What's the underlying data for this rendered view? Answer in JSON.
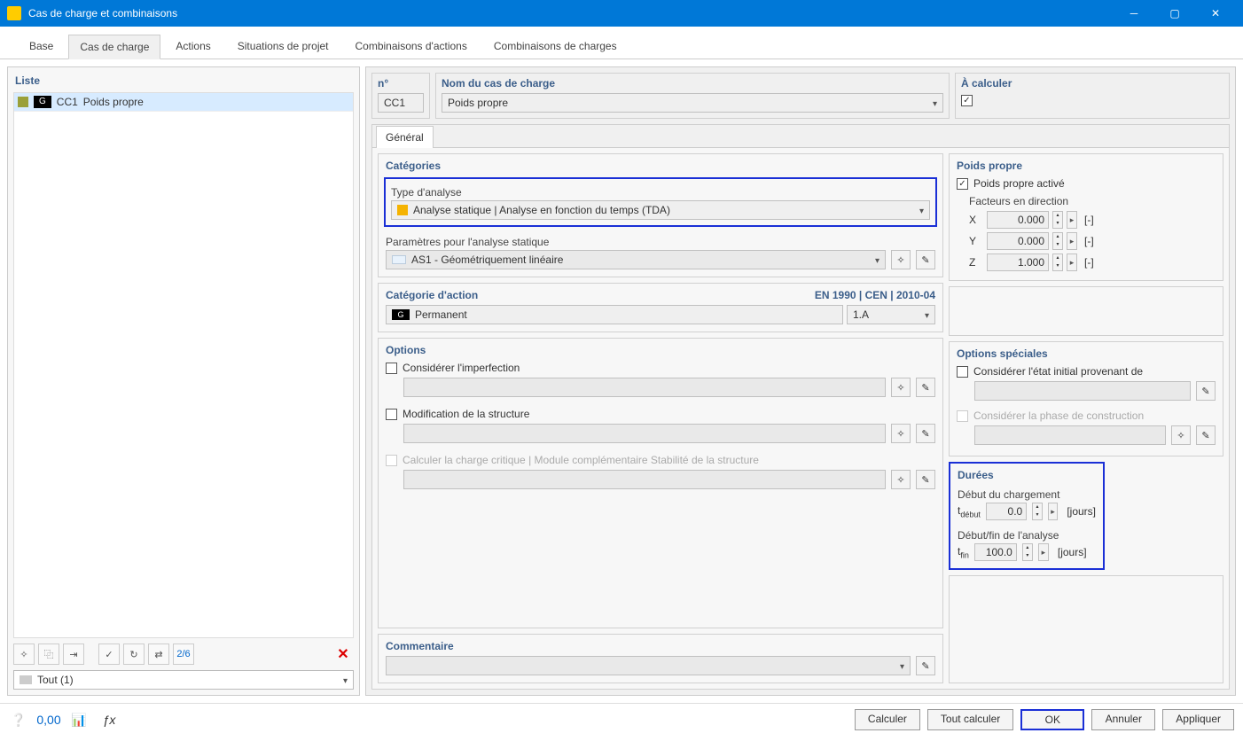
{
  "window": {
    "title": "Cas de charge et combinaisons"
  },
  "tabs": [
    "Base",
    "Cas de charge",
    "Actions",
    "Situations de projet",
    "Combinaisons d'actions",
    "Combinaisons de charges"
  ],
  "active_tab": "Cas de charge",
  "left": {
    "header": "Liste",
    "row": {
      "badge": "G",
      "code": "CC1",
      "name": "Poids propre"
    },
    "filter": "Tout (1)"
  },
  "header": {
    "n_label": "n°",
    "n_value": "CC1",
    "nom_label": "Nom du cas de charge",
    "nom_value": "Poids propre",
    "calc_label": "À calculer"
  },
  "inner_tab": "Général",
  "categories": {
    "title": "Catégories",
    "type_label": "Type d'analyse",
    "type_value": "Analyse statique | Analyse en fonction du temps (TDA)",
    "params_label": "Paramètres pour l'analyse statique",
    "params_value": "AS1 - Géométriquement linéaire"
  },
  "action_cat": {
    "title": "Catégorie d'action",
    "standard": "EN 1990 | CEN | 2010-04",
    "badge": "G",
    "value": "Permanent",
    "code": "1.A"
  },
  "options": {
    "title": "Options",
    "imperfection": "Considérer l'imperfection",
    "structure": "Modification de la structure",
    "critical": "Calculer la charge critique | Module complémentaire Stabilité de la structure"
  },
  "selfweight": {
    "title": "Poids propre",
    "active": "Poids propre activé",
    "factors_label": "Facteurs en direction",
    "rows": [
      {
        "label": "X",
        "value": "0.000",
        "unit": "[-]"
      },
      {
        "label": "Y",
        "value": "0.000",
        "unit": "[-]"
      },
      {
        "label": "Z",
        "value": "1.000",
        "unit": "[-]"
      }
    ]
  },
  "special": {
    "title": "Options spéciales",
    "initial": "Considérer l'état initial provenant de",
    "phase": "Considérer la phase de construction"
  },
  "durations": {
    "title": "Durées",
    "start_label": "Début du chargement",
    "t_start_symbol": "t",
    "t_start_sub": "début",
    "t_start_value": "0.0",
    "end_label": "Début/fin de l'analyse",
    "t_end_symbol": "t",
    "t_end_sub": "fin",
    "t_end_value": "100.0",
    "unit": "[jours]"
  },
  "comment": {
    "title": "Commentaire"
  },
  "footer": {
    "calculer": "Calculer",
    "tout": "Tout calculer",
    "ok": "OK",
    "annuler": "Annuler",
    "appliquer": "Appliquer"
  }
}
